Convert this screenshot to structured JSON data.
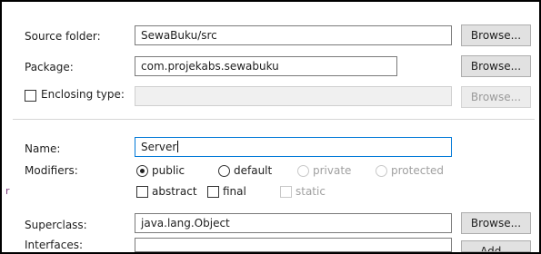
{
  "form": {
    "source_folder": {
      "label": "Source folder:",
      "value": "SewaBuku/src",
      "browse": "Browse..."
    },
    "package": {
      "label": "Package:",
      "value": "com.projekabs.sewabuku",
      "browse": "Browse..."
    },
    "enclosing_type": {
      "label": "Enclosing type:",
      "value": "",
      "browse": "Browse...",
      "checked": false
    },
    "name": {
      "label": "Name:",
      "value": "Server"
    },
    "modifiers": {
      "label": "Modifiers:",
      "public": "public",
      "default": "default",
      "private": "private",
      "protected": "protected",
      "selected": "public",
      "abstract": "abstract",
      "final": "final",
      "static": "static"
    },
    "superclass": {
      "label": "Superclass:",
      "value": "java.lang.Object",
      "browse": "Browse..."
    },
    "interfaces": {
      "label": "Interfaces:",
      "add": "Add..."
    }
  },
  "colors": {
    "focus_border": "#0078d7",
    "button_bg": "#e1e1e1",
    "disabled_text": "#a0a0a0"
  }
}
